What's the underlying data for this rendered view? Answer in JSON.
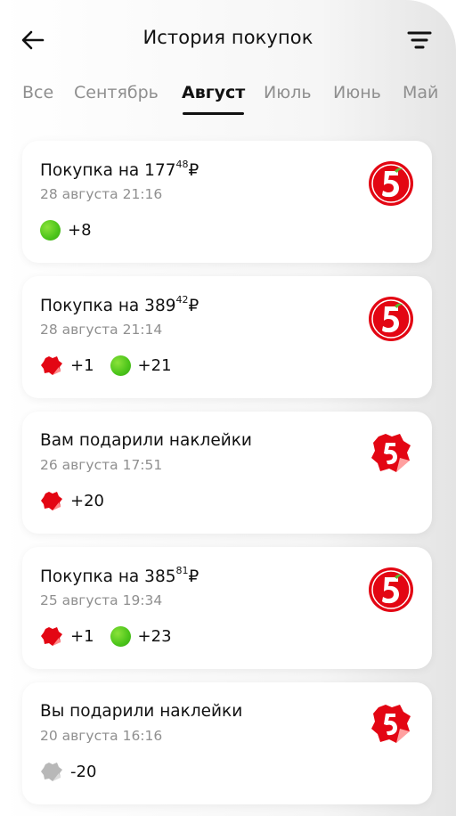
{
  "header": {
    "title": "История покупок",
    "back_icon": "arrow-left-icon",
    "filter_icon": "filter-lines-icon"
  },
  "tabs": [
    {
      "label": "Все",
      "active": false
    },
    {
      "label": "Сентябрь",
      "active": false
    },
    {
      "label": "Август",
      "active": true
    },
    {
      "label": "Июль",
      "active": false
    },
    {
      "label": "Июнь",
      "active": false
    },
    {
      "label": "Май",
      "active": false
    }
  ],
  "colors": {
    "brand_red": "#e30613",
    "accent_green": "#4bc41a",
    "gray_text": "#8f8f8f",
    "sticker_gray": "#b8b8b8"
  },
  "cards": [
    {
      "title_prefix": "Покупка на",
      "amount_main": "177",
      "amount_kopecks": "48",
      "currency": "₽",
      "date": "28 августа 21:16",
      "logo": "pyaterochka-logo",
      "rewards": [
        {
          "type": "points",
          "value": "+8"
        }
      ]
    },
    {
      "title_prefix": "Покупка на",
      "amount_main": "389",
      "amount_kopecks": "42",
      "currency": "₽",
      "date": "28 августа 21:14",
      "logo": "pyaterochka-logo",
      "rewards": [
        {
          "type": "sticker",
          "value": "+1"
        },
        {
          "type": "points",
          "value": "+21"
        }
      ]
    },
    {
      "title": "Вам подарили наклейки",
      "date": "26 августа 17:51",
      "logo": "sticker-logo",
      "rewards": [
        {
          "type": "sticker",
          "value": "+20"
        }
      ]
    },
    {
      "title_prefix": "Покупка на",
      "amount_main": "385",
      "amount_kopecks": "81",
      "currency": "₽",
      "date": "25 августа 19:34",
      "logo": "pyaterochka-logo",
      "rewards": [
        {
          "type": "sticker",
          "value": "+1"
        },
        {
          "type": "points",
          "value": "+23"
        }
      ]
    },
    {
      "title": "Вы подарили наклейки",
      "date": "20 августа 16:16",
      "logo": "sticker-logo",
      "rewards": [
        {
          "type": "sticker-gray",
          "value": "-20"
        }
      ]
    }
  ]
}
